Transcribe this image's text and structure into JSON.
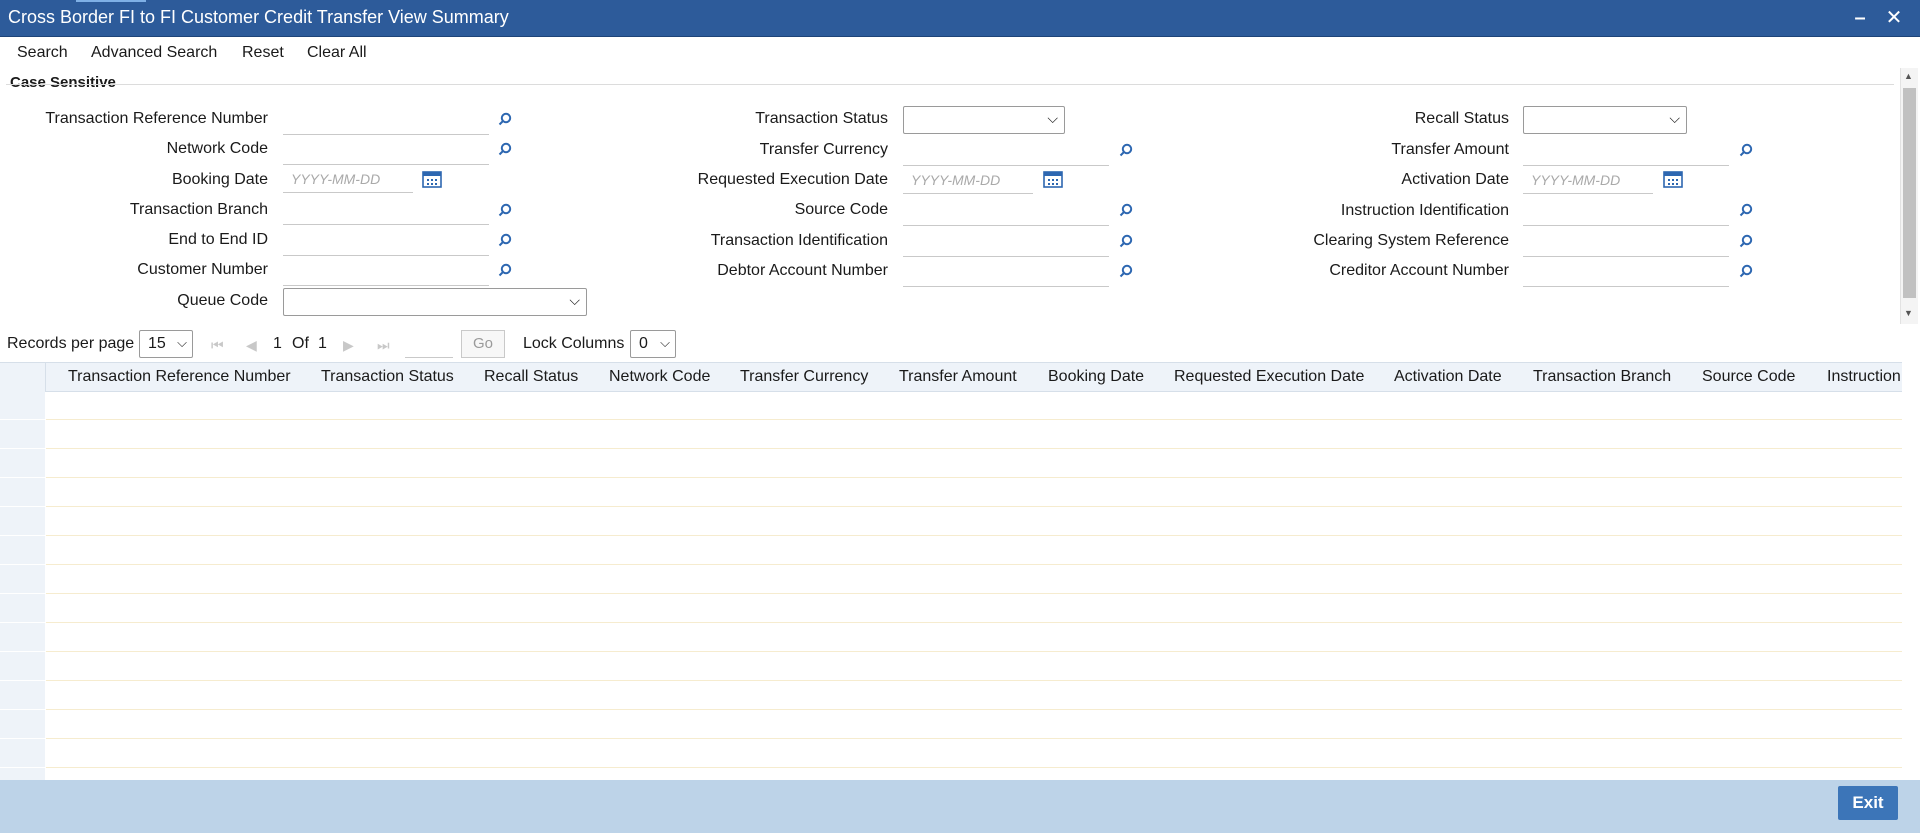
{
  "window": {
    "title": "Cross Border FI to FI Customer Credit Transfer View Summary",
    "minimize_icon": "minimize-icon",
    "close_icon": "close-icon"
  },
  "menu": {
    "search": "Search",
    "advanced_search": "Advanced Search",
    "reset": "Reset",
    "clear_all": "Clear All"
  },
  "criteria": {
    "section_title": "Case Sensitive",
    "date_placeholder": "YYYY-MM-DD",
    "col1": {
      "transaction_reference_number": "Transaction Reference Number",
      "network_code": "Network Code",
      "booking_date": "Booking Date",
      "transaction_branch": "Transaction Branch",
      "end_to_end_id": "End to End ID",
      "customer_number": "Customer Number",
      "queue_code": "Queue Code"
    },
    "col2": {
      "transaction_status": "Transaction Status",
      "transfer_currency": "Transfer Currency",
      "requested_execution_date": "Requested Execution Date",
      "source_code": "Source Code",
      "transaction_identification": "Transaction Identification",
      "debtor_account_number": "Debtor Account Number"
    },
    "col3": {
      "recall_status": "Recall Status",
      "transfer_amount": "Transfer Amount",
      "activation_date": "Activation Date",
      "instruction_identification": "Instruction Identification",
      "clearing_system_reference": "Clearing System Reference",
      "creditor_account_number": "Creditor Account Number"
    }
  },
  "pager": {
    "records_per_page_label": "Records per page",
    "records_per_page_value": "15",
    "current_page": "1",
    "of_label": "Of",
    "total_pages": "1",
    "go_label": "Go",
    "lock_columns_label": "Lock Columns",
    "lock_columns_value": "0"
  },
  "grid": {
    "columns": [
      "Transaction Reference Number",
      "Transaction Status",
      "Recall Status",
      "Network Code",
      "Transfer Currency",
      "Transfer Amount",
      "Booking Date",
      "Requested Execution Date",
      "Activation Date",
      "Transaction Branch",
      "Source Code",
      "Instruction"
    ],
    "row_count": 15
  },
  "footer": {
    "exit_label": "Exit"
  }
}
